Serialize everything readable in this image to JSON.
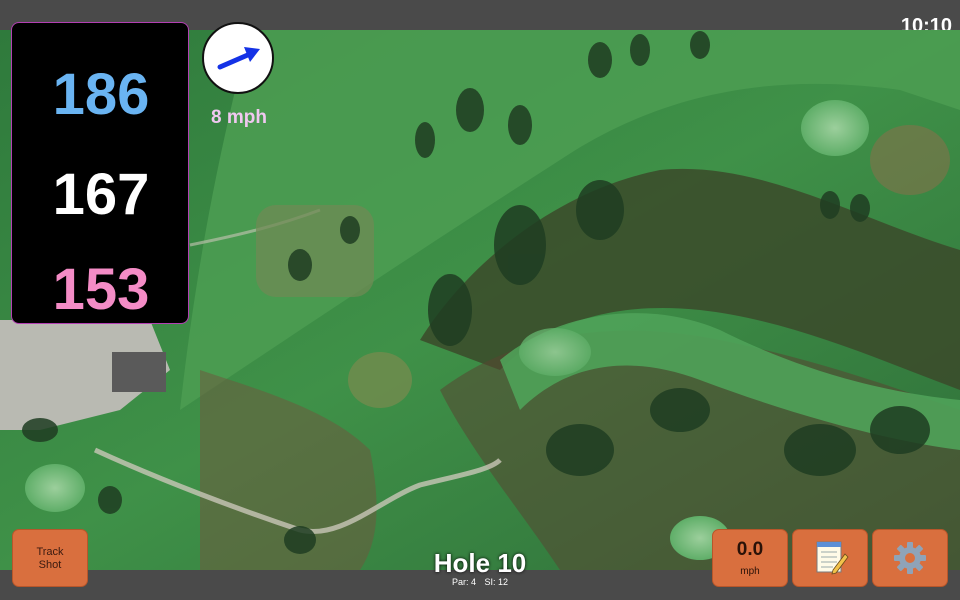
{
  "status": {
    "time": "10:10"
  },
  "distances": {
    "back": "186",
    "middle": "167",
    "front": "153"
  },
  "wind": {
    "speed_label": "8 mph",
    "direction_icon": "arrow-icon"
  },
  "buttons": {
    "track_shot_line1": "Track",
    "track_shot_line2": "Shot",
    "wind_value": "0.0",
    "wind_unit": "mph",
    "notes_icon": "notepad-icon",
    "settings_icon": "gear-icon"
  },
  "hole": {
    "title": "Hole 10",
    "par": "Par: 4",
    "si": "SI: 12"
  },
  "colors": {
    "back_distance": "#6ab4f2",
    "middle_distance": "#ffffff",
    "front_distance": "#f48cc6",
    "button_accent": "#d96f3e"
  }
}
